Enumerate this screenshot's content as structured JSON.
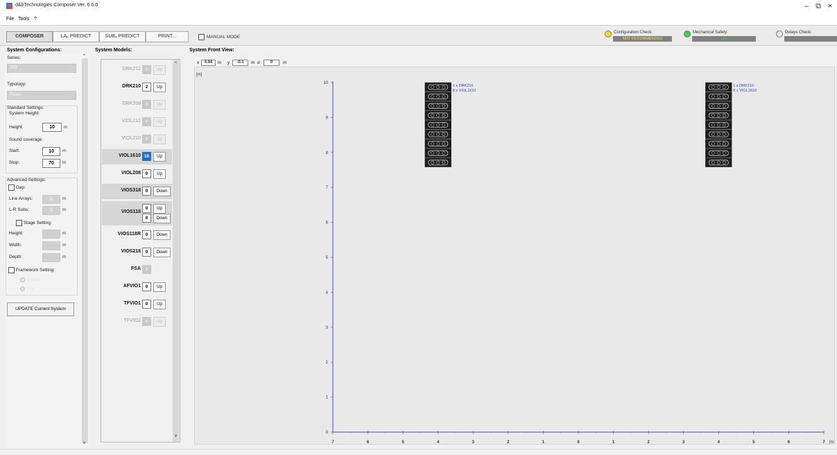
{
  "window": {
    "title": "d&bTechnologies Composer Ver. 6.6.0",
    "minimize": "–",
    "maximize": "⧉",
    "close": "×"
  },
  "menu": [
    "File",
    "Tools",
    "?"
  ],
  "tabs": [
    "COMPOSER",
    "LAₑ PREDICT",
    "SUBₑ PREDICT",
    "PRINT..."
  ],
  "manual_mode": "MANUAL MODE",
  "status": {
    "config_label": "Configuration Check:",
    "config_value": "NOT RECOMMENDED",
    "config_color": "#f0e020",
    "mech_label": "Mechanical Safety:",
    "mech_value": "OK",
    "mech_color": "#3ad83a",
    "delays_label": "Delays Check:",
    "delays_value": ""
  },
  "left": {
    "title": "System Configurations:",
    "series_label": "Series:",
    "series_value": "VIO",
    "typology_label": "Typology:",
    "typology_value": "Flown",
    "standard_title": "Standard Settings:",
    "system_height_label": "System Height:",
    "height_label": "Height:",
    "height_value": "10",
    "height_unit": "m",
    "coverage_label": "Sound coverage:",
    "start_label": "Start:",
    "start_value": "10",
    "start_unit": "m",
    "stop_label": "Stop:",
    "stop_value": "70",
    "stop_unit": "m",
    "advanced_title": "Advanced Settings:",
    "gap_label": "Gap:",
    "line_arrays_label": "Line Arrays:",
    "line_arrays_value": "0",
    "line_arrays_unit": "m",
    "lr_subs_label": "L-R Subs:",
    "lr_subs_value": "0",
    "lr_subs_unit": "m",
    "stage_label": "Stage Setting:",
    "stage_height_label": "Height:",
    "stage_width_label": "Width:",
    "stage_depth_label": "Depth:",
    "stage_unit": "m",
    "framework_label": "Framework Setting:",
    "radio1": "Bottom",
    "radio2": "Top",
    "update_button": "UPDATE Current System"
  },
  "models": {
    "title": "System Models:",
    "rows": [
      {
        "name": "DRK212",
        "qty": "0",
        "btn": "Up",
        "enabled": false
      },
      {
        "name": "DRK210",
        "qty": "2",
        "btn": "Up",
        "enabled": true
      },
      {
        "name": "DRK208",
        "qty": "0",
        "btn": "Up",
        "enabled": false
      },
      {
        "name": "VIOL212",
        "qty": "0",
        "btn": "Up",
        "enabled": false
      },
      {
        "name": "VIOL210",
        "qty": "0",
        "btn": "Up",
        "enabled": false
      },
      {
        "name": "VIOL1610",
        "qty": "16",
        "btn": "Up",
        "enabled": true,
        "selected": true
      },
      {
        "name": "VIOL208",
        "qty": "0",
        "btn": "Up",
        "enabled": true
      },
      {
        "name": "VIOS318",
        "qty": "0",
        "btn": "Down",
        "enabled": true
      },
      {
        "name": "VIOS118",
        "qty": "0",
        "btn": "Up",
        "qty2": "0",
        "btn2": "Down",
        "enabled": true
      },
      {
        "name": "VIOS118R",
        "qty": "0",
        "btn": "Down",
        "enabled": true
      },
      {
        "name": "VIOS218",
        "qty": "0",
        "btn": "Down",
        "enabled": true
      },
      {
        "name": "FSA",
        "qty": "0",
        "enabled": true,
        "qty_disabled": true
      },
      {
        "name": "AFVIO1",
        "qty": "0",
        "btn": "Up",
        "enabled": true
      },
      {
        "name": "TFVIO1",
        "qty": "0",
        "btn": "Up",
        "enabled": true
      },
      {
        "name": "TFVIO2",
        "qty": "0",
        "btn": "Up",
        "enabled": false
      }
    ]
  },
  "view": {
    "title": "System Front View:",
    "x_label": "x",
    "x_value": "4.94",
    "y_label": "y",
    "y_value": "-0.1",
    "d_label": "d",
    "d_value": "0",
    "unit": "m",
    "y_unit": "[m]",
    "x_unit": "[m]",
    "y_ticks": [
      "0",
      "1",
      "2",
      "3",
      "4",
      "5",
      "6",
      "7",
      "8",
      "9",
      "10"
    ],
    "x_ticks": [
      "7",
      "6",
      "5",
      "4",
      "3",
      "2",
      "1",
      "0",
      "1",
      "2",
      "3",
      "4",
      "5",
      "6",
      "7"
    ],
    "arrays": [
      {
        "center_m": -4,
        "top_m": 10,
        "cabinets": 9,
        "label1": "1 x DRK210",
        "label2": "8 x VIOL1610"
      },
      {
        "center_m": 4,
        "top_m": 10,
        "cabinets": 9,
        "label1": "1 x DRK210",
        "label2": "8 x VIOL1610"
      }
    ],
    "axis_color": "#4a4ae0",
    "label_color": "#3a3ad8"
  }
}
